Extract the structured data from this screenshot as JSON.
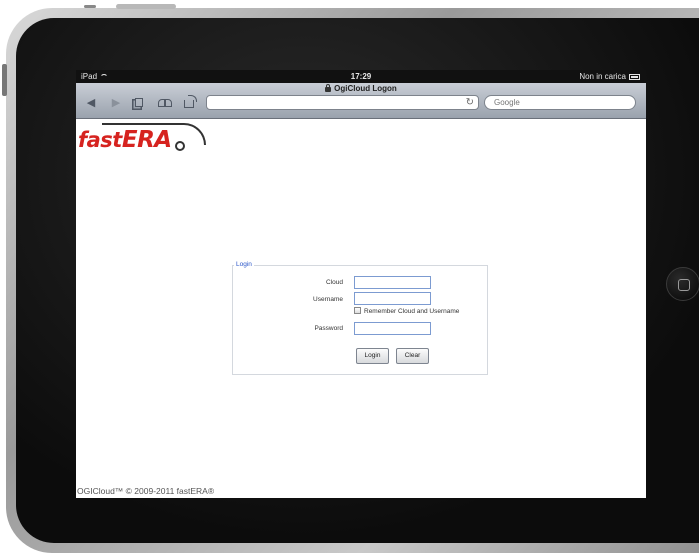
{
  "status_bar": {
    "device": "iPad",
    "time": "17:29",
    "battery_text": "Non in carica"
  },
  "browser": {
    "page_title": "OgiCloud Logon",
    "url": "",
    "search_placeholder": "Google",
    "back_icon": "back-arrow-icon",
    "forward_icon": "forward-arrow-icon",
    "pages_icon": "pages-icon",
    "bookmarks_icon": "bookmarks-icon",
    "share_icon": "share-icon",
    "reload_icon": "reload-icon"
  },
  "logo": {
    "part1": "fast",
    "part2": "ERA",
    "color": "#d6231f"
  },
  "login": {
    "legend": "Login",
    "cloud_label": "Cloud",
    "cloud_value": "",
    "username_label": "Username",
    "username_value": "",
    "remember_label": "Remember Cloud and Username",
    "remember_checked": false,
    "password_label": "Password",
    "password_value": "",
    "login_button": "Login",
    "clear_button": "Clear",
    "legend_color": "#2a55c8"
  },
  "footer": {
    "copyright": "OGICloud™ © 2009-2011 fastERA®"
  }
}
